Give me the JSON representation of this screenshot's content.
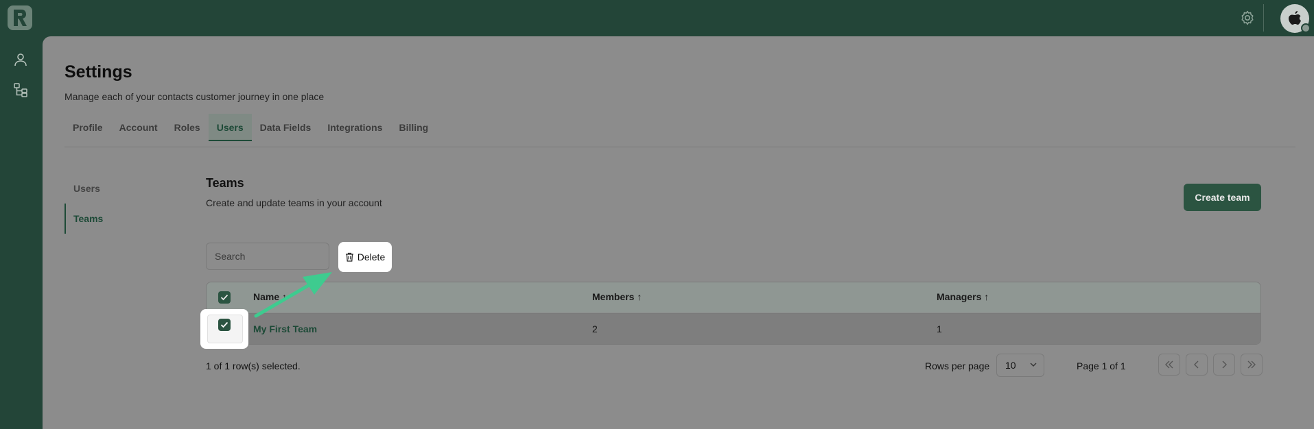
{
  "header": {
    "logo_letter": "R",
    "icons": [
      "gear-icon",
      "avatar"
    ]
  },
  "rail": {
    "icons": [
      "user-icon",
      "org-chart-icon"
    ]
  },
  "page": {
    "title": "Settings",
    "subtitle": "Manage each of your contacts customer journey in one place"
  },
  "tabs": [
    {
      "label": "Profile"
    },
    {
      "label": "Account"
    },
    {
      "label": "Roles"
    },
    {
      "label": "Users",
      "active": true
    },
    {
      "label": "Data Fields"
    },
    {
      "label": "Integrations"
    },
    {
      "label": "Billing"
    }
  ],
  "subnav": [
    {
      "label": "Users"
    },
    {
      "label": "Teams",
      "active": true
    }
  ],
  "section": {
    "title": "Teams",
    "subtitle": "Create and update teams in your account",
    "create_button": "Create team"
  },
  "toolbar": {
    "search_placeholder": "Search",
    "delete_label": "Delete"
  },
  "table": {
    "columns": [
      "Name ↑",
      "Members ↑",
      "Managers ↑"
    ],
    "rows": [
      {
        "name": "My First Team",
        "members": "2",
        "managers": "1",
        "selected": true
      }
    ]
  },
  "footer": {
    "selection": "1 of 1 row(s) selected.",
    "rows_per_page_label": "Rows per page",
    "rows_per_page_value": "10",
    "page_label": "Page 1 of 1"
  },
  "colors": {
    "brand": "#234538",
    "accent": "#2b5441",
    "arrow": "#3ecb8f"
  }
}
